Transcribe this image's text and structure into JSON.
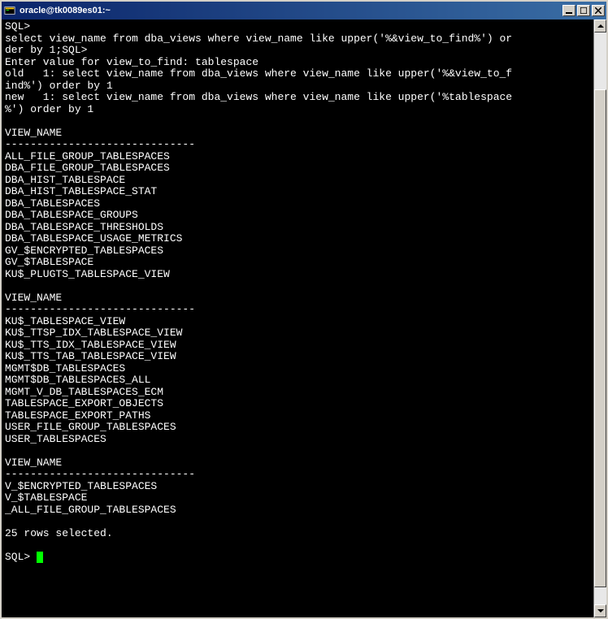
{
  "window": {
    "title": "oracle@tk0089es01:~"
  },
  "terminal": {
    "lines": [
      "SQL>",
      "select view_name from dba_views where view_name like upper('%&view_to_find%') or",
      "der by 1;SQL>",
      "Enter value for view_to_find: tablespace",
      "old   1: select view_name from dba_views where view_name like upper('%&view_to_f",
      "ind%') order by 1",
      "new   1: select view_name from dba_views where view_name like upper('%tablespace",
      "%') order by 1",
      "",
      "VIEW_NAME",
      "------------------------------",
      "ALL_FILE_GROUP_TABLESPACES",
      "DBA_FILE_GROUP_TABLESPACES",
      "DBA_HIST_TABLESPACE",
      "DBA_HIST_TABLESPACE_STAT",
      "DBA_TABLESPACES",
      "DBA_TABLESPACE_GROUPS",
      "DBA_TABLESPACE_THRESHOLDS",
      "DBA_TABLESPACE_USAGE_METRICS",
      "GV_$ENCRYPTED_TABLESPACES",
      "GV_$TABLESPACE",
      "KU$_PLUGTS_TABLESPACE_VIEW",
      "",
      "VIEW_NAME",
      "------------------------------",
      "KU$_TABLESPACE_VIEW",
      "KU$_TTSP_IDX_TABLESPACE_VIEW",
      "KU$_TTS_IDX_TABLESPACE_VIEW",
      "KU$_TTS_TAB_TABLESPACE_VIEW",
      "MGMT$DB_TABLESPACES",
      "MGMT$DB_TABLESPACES_ALL",
      "MGMT_V_DB_TABLESPACES_ECM",
      "TABLESPACE_EXPORT_OBJECTS",
      "TABLESPACE_EXPORT_PATHS",
      "USER_FILE_GROUP_TABLESPACES",
      "USER_TABLESPACES",
      "",
      "VIEW_NAME",
      "------------------------------",
      "V_$ENCRYPTED_TABLESPACES",
      "V_$TABLESPACE",
      "_ALL_FILE_GROUP_TABLESPACES",
      "",
      "25 rows selected.",
      "",
      "SQL> "
    ]
  },
  "scrollbar": {
    "thumb_top_pct": 10,
    "thumb_height_pct": 87
  }
}
